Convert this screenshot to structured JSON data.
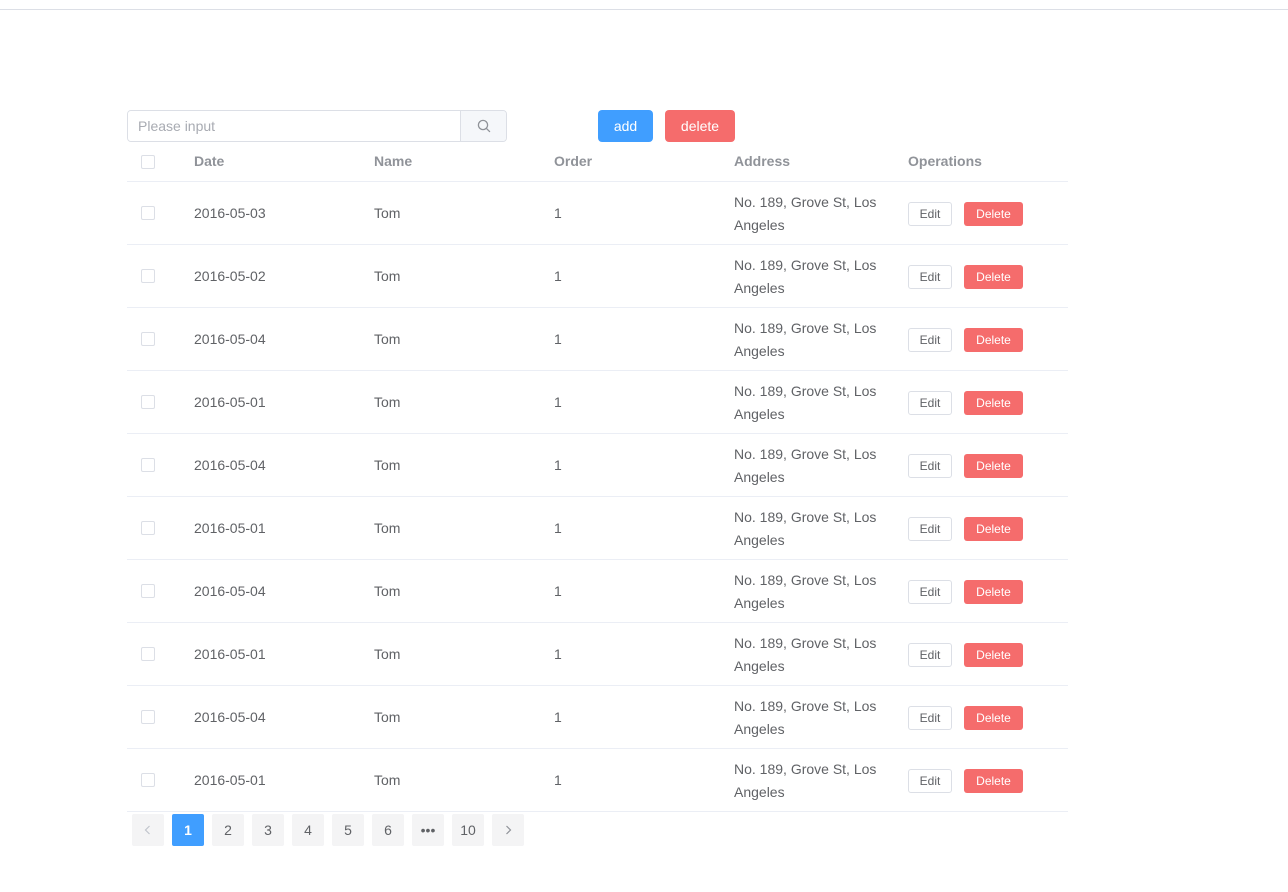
{
  "search": {
    "placeholder": "Please input"
  },
  "toolbar": {
    "add_label": "add",
    "delete_label": "delete"
  },
  "table": {
    "headers": {
      "date": "Date",
      "name": "Name",
      "order": "Order",
      "address": "Address",
      "operations": "Operations"
    },
    "rows": [
      {
        "date": "2016-05-03",
        "name": "Tom",
        "order": "1",
        "address": "No. 189, Grove St, Los Angeles",
        "edit": "Edit",
        "delete": "Delete"
      },
      {
        "date": "2016-05-02",
        "name": "Tom",
        "order": "1",
        "address": "No. 189, Grove St, Los Angeles",
        "edit": "Edit",
        "delete": "Delete"
      },
      {
        "date": "2016-05-04",
        "name": "Tom",
        "order": "1",
        "address": "No. 189, Grove St, Los Angeles",
        "edit": "Edit",
        "delete": "Delete"
      },
      {
        "date": "2016-05-01",
        "name": "Tom",
        "order": "1",
        "address": "No. 189, Grove St, Los Angeles",
        "edit": "Edit",
        "delete": "Delete"
      },
      {
        "date": "2016-05-04",
        "name": "Tom",
        "order": "1",
        "address": "No. 189, Grove St, Los Angeles",
        "edit": "Edit",
        "delete": "Delete"
      },
      {
        "date": "2016-05-01",
        "name": "Tom",
        "order": "1",
        "address": "No. 189, Grove St, Los Angeles",
        "edit": "Edit",
        "delete": "Delete"
      },
      {
        "date": "2016-05-04",
        "name": "Tom",
        "order": "1",
        "address": "No. 189, Grove St, Los Angeles",
        "edit": "Edit",
        "delete": "Delete"
      },
      {
        "date": "2016-05-01",
        "name": "Tom",
        "order": "1",
        "address": "No. 189, Grove St, Los Angeles",
        "edit": "Edit",
        "delete": "Delete"
      },
      {
        "date": "2016-05-04",
        "name": "Tom",
        "order": "1",
        "address": "No. 189, Grove St, Los Angeles",
        "edit": "Edit",
        "delete": "Delete"
      },
      {
        "date": "2016-05-01",
        "name": "Tom",
        "order": "1",
        "address": "No. 189, Grove St, Los Angeles",
        "edit": "Edit",
        "delete": "Delete"
      }
    ]
  },
  "pagination": {
    "pages": [
      "1",
      "2",
      "3",
      "4",
      "5",
      "6",
      "•••",
      "10"
    ],
    "current": "1",
    "prev_icon": "chevron-left-icon",
    "next_icon": "chevron-right-icon"
  },
  "icons": {
    "search": "search-icon"
  },
  "colors": {
    "primary": "#409eff",
    "danger": "#f56c6c",
    "border": "#dcdfe6"
  }
}
